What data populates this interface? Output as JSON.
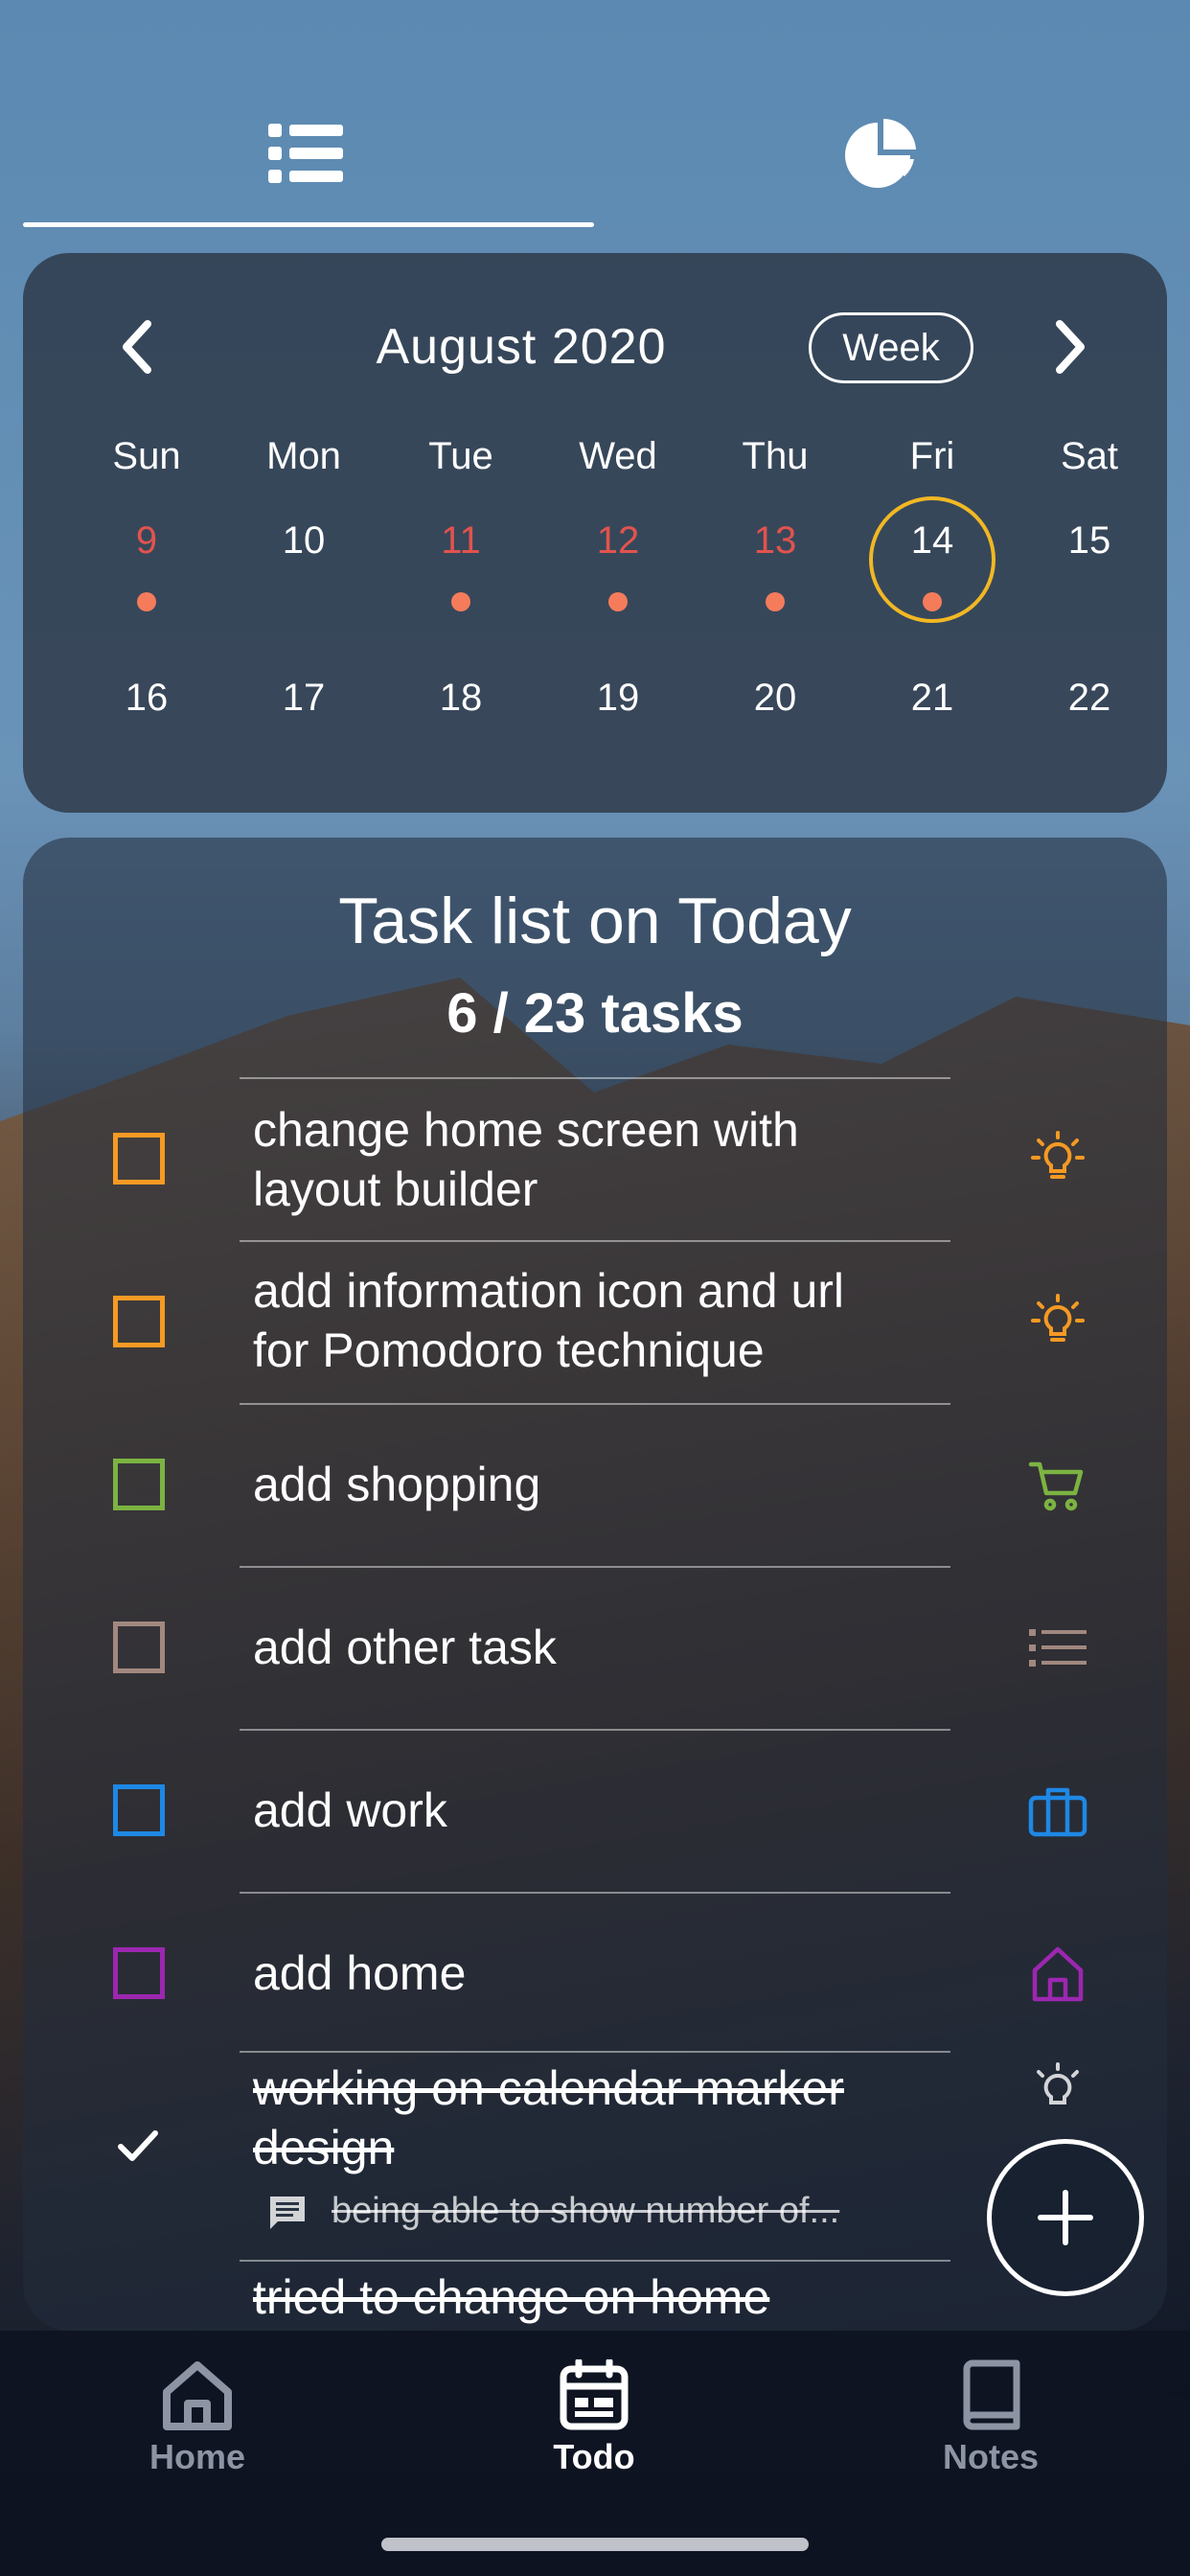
{
  "tabs": {
    "list_icon": "list-icon",
    "chart_icon": "pie-chart-icon"
  },
  "calendar": {
    "month_label": "August 2020",
    "view_toggle": "Week",
    "weekdays": [
      "Sun",
      "Mon",
      "Tue",
      "Wed",
      "Thu",
      "Fri",
      "Sat"
    ],
    "week1": [
      "9",
      "10",
      "11",
      "12",
      "13",
      "14",
      "15"
    ],
    "week2": [
      "16",
      "17",
      "18",
      "19",
      "20",
      "21",
      "22"
    ],
    "selected_day": "14",
    "accent_red": "#e2534d",
    "accent_today": "#f1b823"
  },
  "task_list": {
    "title": "Task list on Today",
    "count": "6 / 23 tasks",
    "items": [
      {
        "text": "change home screen with layout builder",
        "line1": "change home screen with",
        "line2": "layout builder",
        "color": "#f59a23",
        "icon": "lightbulb-icon"
      },
      {
        "text": "add information icon and url for Pomodoro technique",
        "line1": "add information icon and url",
        "line2": "for Pomodoro technique",
        "color": "#f59a23",
        "icon": "lightbulb-icon"
      },
      {
        "text": "add shopping",
        "color": "#7cb342",
        "icon": "shopping-cart-icon"
      },
      {
        "text": "add other task",
        "color": "#a1887f",
        "icon": "list-icon"
      },
      {
        "text": "add work",
        "color": "#1e88e5",
        "icon": "briefcase-icon"
      },
      {
        "text": "add home",
        "color": "#9c27b0",
        "icon": "home-icon"
      }
    ],
    "done_items": [
      {
        "line1": "working on calendar marker",
        "line2": "design",
        "note": "being able to show number of...",
        "icon": "lightbulb-icon"
      },
      {
        "line1": "tried to change on home"
      }
    ]
  },
  "fab_icon": "plus-icon",
  "bottom_nav": {
    "home": "Home",
    "todo": "Todo",
    "notes": "Notes"
  }
}
